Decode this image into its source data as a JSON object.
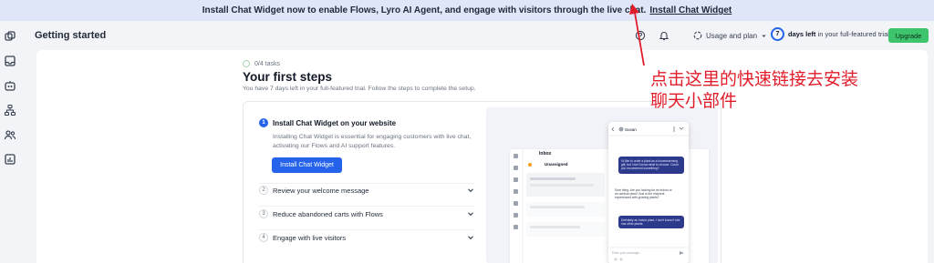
{
  "banner": {
    "text": "Install Chat Widget now to enable Flows, Lyro AI Agent, and engage with visitors through the live chat.",
    "link": "Install Chat Widget"
  },
  "header": {
    "title": "Getting started",
    "usage_label": "Usage and plan",
    "trial_days": "7",
    "trial_bold": "days left",
    "trial_rest": "in your full-featured trial",
    "upgrade_label": "Upgrade"
  },
  "sidebar": {
    "icons": [
      "layers-icon",
      "inbox-icon",
      "bot-icon",
      "flows-icon",
      "contacts-icon",
      "analytics-icon"
    ]
  },
  "onboarding": {
    "tasks": "0/4 tasks",
    "title": "Your first steps",
    "subtitle": "You have 7 days left in your full-featured trial. Follow the steps to complete the setup.",
    "steps": [
      {
        "number": "1",
        "label": "Install Chat Widget on your website",
        "description": "Installing Chat Widget is essential for engaging customers with live chat, activating our Flows and AI support features.",
        "button": "Install Chat Widget"
      },
      {
        "number": "2",
        "label": "Review your welcome message"
      },
      {
        "number": "3",
        "label": "Reduce abandoned carts with Flows"
      },
      {
        "number": "4",
        "label": "Engage with live visitors"
      }
    ]
  },
  "preview": {
    "inbox_title": "Inbox",
    "unassigned": "Unassigned",
    "contact_name": "Susan",
    "messages": [
      "I'd like to order a plant as a housewarming gift, but I don't know what to choose. Could you recommend something?",
      "Sure thing. Are you looking for an indoor or an outdoor plant? And is the recipient experienced with growing plants?",
      "Definitely an indoor plant. I don't know if she has other plants."
    ],
    "input_placeholder": "Enter your message..."
  },
  "annotation": {
    "line1": "点击这里的快速链接去安装",
    "line2": "聊天小部件",
    "color": "#e11d2b"
  },
  "colors": {
    "accent": "#2563eb",
    "upgrade": "#3ec46d",
    "banner": "#dfe6f8"
  }
}
